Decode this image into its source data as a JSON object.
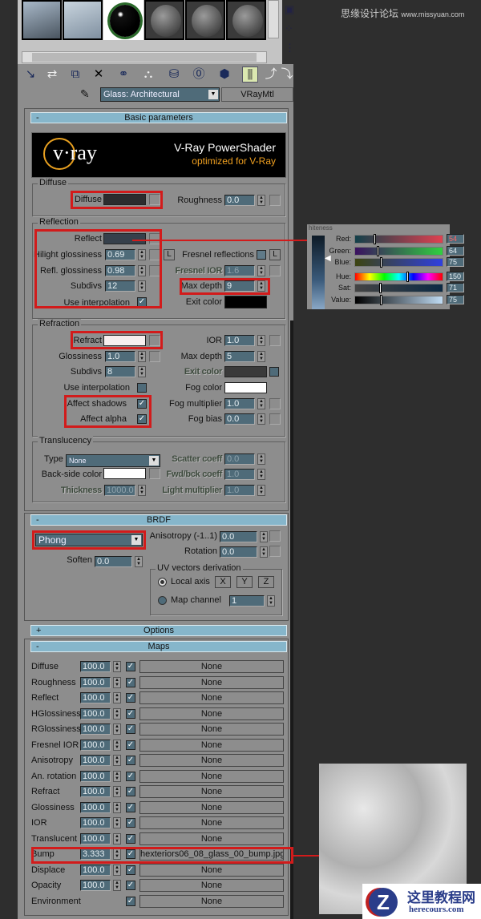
{
  "watermark": {
    "site_cn": "思缘设计论坛",
    "site_url": "www.missyuan.com"
  },
  "material_type_dropdown": {
    "value": "Glass: Architectural"
  },
  "material_class_button": {
    "label": "VRayMtl"
  },
  "rollouts": {
    "basic": {
      "title": "Basic parameters",
      "toggle": "-"
    },
    "brdf": {
      "title": "BRDF",
      "toggle": "-"
    },
    "options": {
      "title": "Options",
      "toggle": "+"
    },
    "maps": {
      "title": "Maps",
      "toggle": "-"
    }
  },
  "vray_banner": {
    "logo": "v·ray",
    "title": "V-Ray PowerShader",
    "subtitle": "optimized for V-Ray"
  },
  "diffuse": {
    "group": "Diffuse",
    "diffuse_label": "Diffuse",
    "diffuse_color": "#2c2c2e",
    "roughness_label": "Roughness",
    "roughness": "0.0"
  },
  "reflection": {
    "group": "Reflection",
    "reflect_label": "Reflect",
    "reflect_color": "#36404b",
    "hilight_label": "Hilight glossiness",
    "hilight": "0.69",
    "lock_label": "L",
    "refl_gloss_label": "Refl. glossiness",
    "refl_gloss": "0.98",
    "subdivs_label": "Subdivs",
    "subdivs": "12",
    "use_interp_label": "Use interpolation",
    "use_interp": true,
    "fresnel_label": "Fresnel reflections",
    "fresnel_lock": "L",
    "fresnel_ior_label": "Fresnel IOR",
    "fresnel_ior": "1.6",
    "max_depth_label": "Max depth",
    "max_depth": "9",
    "exit_color_label": "Exit color",
    "exit_color": "#000000"
  },
  "refraction": {
    "group": "Refraction",
    "refract_label": "Refract",
    "refract_color": "#f6eeee",
    "gloss_label": "Glossiness",
    "gloss": "1.0",
    "subdivs_label": "Subdivs",
    "subdivs": "8",
    "use_interp_label": "Use interpolation",
    "affect_shadows_label": "Affect shadows",
    "affect_alpha_label": "Affect alpha",
    "ior_label": "IOR",
    "ior": "1.0",
    "max_depth_label": "Max depth",
    "max_depth": "5",
    "exit_color_label": "Exit color",
    "exit_color": "#3a3a3a",
    "fog_color_label": "Fog color",
    "fog_color": "#ffffff",
    "fog_mult_label": "Fog multiplier",
    "fog_mult": "1.0",
    "fog_bias_label": "Fog bias",
    "fog_bias": "0.0"
  },
  "translucency": {
    "group": "Translucency",
    "type_label": "Type",
    "type": "None",
    "backside_label": "Back-side color",
    "thickness_label": "Thickness",
    "thickness": "1000.0",
    "scatter_label": "Scatter coeff",
    "scatter": "0.0",
    "fwdbck_label": "Fwd/bck coeff",
    "fwdbck": "1.0",
    "light_mult_label": "Light multiplier",
    "light_mult": "1.0"
  },
  "brdf": {
    "type": "Phong",
    "soften_label": "Soften",
    "soften": "0.0",
    "aniso_label": "Anisotropy (-1..1)",
    "aniso": "0.0",
    "rotation_label": "Rotation",
    "rotation": "0.0",
    "uv_group": "UV vectors derivation",
    "local_axis_label": "Local axis",
    "axes": [
      "X",
      "Y",
      "Z"
    ],
    "map_channel_label": "Map channel",
    "map_channel": "1"
  },
  "maps": [
    {
      "name": "Diffuse",
      "amount": "100.0",
      "on": true,
      "map": "None"
    },
    {
      "name": "Roughness",
      "amount": "100.0",
      "on": true,
      "map": "None"
    },
    {
      "name": "Reflect",
      "amount": "100.0",
      "on": true,
      "map": "None"
    },
    {
      "name": "HGlossiness",
      "amount": "100.0",
      "on": true,
      "map": "None"
    },
    {
      "name": "RGlossiness",
      "amount": "100.0",
      "on": true,
      "map": "None"
    },
    {
      "name": "Fresnel IOR",
      "amount": "100.0",
      "on": true,
      "map": "None"
    },
    {
      "name": "Anisotropy",
      "amount": "100.0",
      "on": true,
      "map": "None"
    },
    {
      "name": "An. rotation",
      "amount": "100.0",
      "on": true,
      "map": "None"
    },
    {
      "name": "Refract",
      "amount": "100.0",
      "on": true,
      "map": "None"
    },
    {
      "name": "Glossiness",
      "amount": "100.0",
      "on": true,
      "map": "None"
    },
    {
      "name": "IOR",
      "amount": "100.0",
      "on": true,
      "map": "None"
    },
    {
      "name": "Translucent",
      "amount": "100.0",
      "on": true,
      "map": "None"
    },
    {
      "name": "Bump",
      "amount": "3.333",
      "on": true,
      "map": "hexteriors06_08_glass_00_bump.jpg)"
    },
    {
      "name": "Displace",
      "amount": "100.0",
      "on": true,
      "map": "None"
    },
    {
      "name": "Opacity",
      "amount": "100.0",
      "on": true,
      "map": "None"
    },
    {
      "name": "Environment",
      "amount": "",
      "on": true,
      "map": "None"
    }
  ],
  "color_picker": {
    "title": "hiteness",
    "channels": [
      {
        "label": "Red:",
        "value": "54",
        "pos": 0.21
      },
      {
        "label": "Green:",
        "value": "64",
        "pos": 0.25
      },
      {
        "label": "Blue:",
        "value": "75",
        "pos": 0.29
      },
      {
        "label": "Hue:",
        "value": "150",
        "pos": 0.59
      },
      {
        "label": "Sat:",
        "value": "71",
        "pos": 0.28
      },
      {
        "label": "Value:",
        "value": "75",
        "pos": 0.29
      }
    ]
  },
  "site_logo": {
    "cn": "这里教程网",
    "url": "herecours.com"
  }
}
